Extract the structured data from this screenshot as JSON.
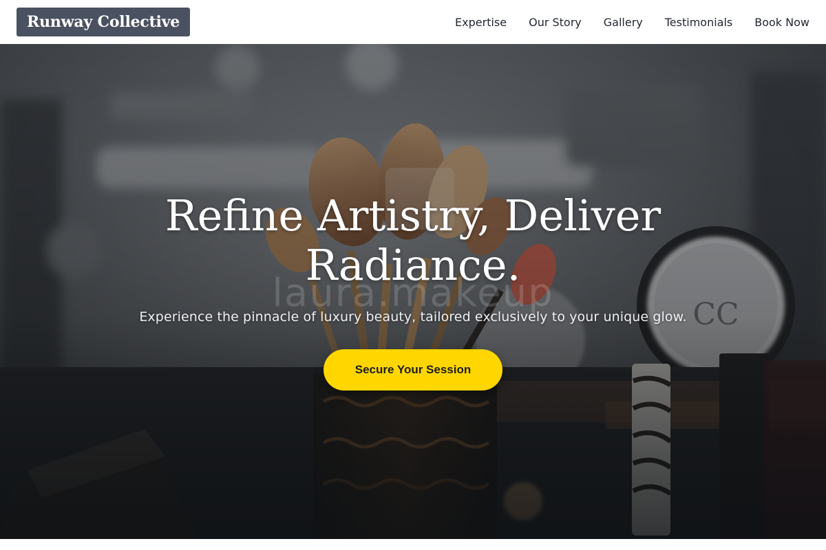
{
  "header": {
    "logo": "Runway Collective",
    "nav": [
      {
        "label": "Expertise"
      },
      {
        "label": "Our Story"
      },
      {
        "label": "Gallery"
      },
      {
        "label": "Testimonials"
      },
      {
        "label": "Book Now"
      }
    ]
  },
  "hero": {
    "title_line1": "Refine Artistry, Deliver",
    "title_line2": "Radiance.",
    "watermark": "laura.makeup",
    "subtitle": "Experience the pinnacle of luxury beauty, tailored exclusively to your unique glow.",
    "cta_label": "Secure Your Session",
    "background_image": "makeup-brushes-photo"
  },
  "colors": {
    "logo_bg": "#4a5160",
    "cta_bg": "#ffd600",
    "nav_text": "#222831",
    "hero_text": "#ffffff"
  }
}
